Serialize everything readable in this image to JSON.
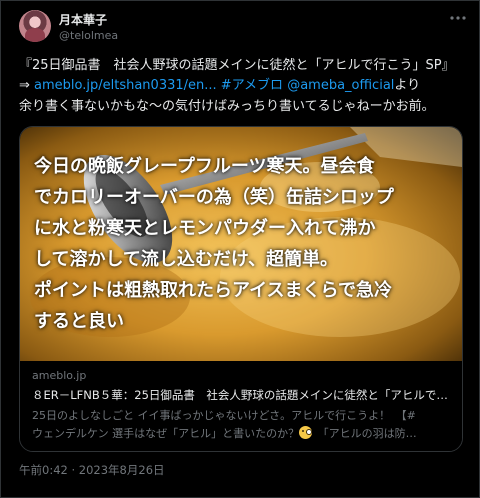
{
  "user": {
    "display_name": "月本華子",
    "handle": "@telolmea"
  },
  "icons": {
    "more": "more-icon"
  },
  "tweet": {
    "line1": "『25日御品書　社会人野球の話題メインに徒然と「アヒルで行こう」SP』",
    "line2_prefix": "⇒ ",
    "line2_link": "ameblo.jp/eltshan0331/en...",
    "line2_hashtag": "#アメブロ",
    "line2_mention": "@ameba_official",
    "line2_suffix": "より",
    "line3": "余り書く事ないかもな～の気付けばみっちり書いてるじゃねーかお前。"
  },
  "card": {
    "image_text": [
      "今日の晩飯グレープフルーツ寒天。昼会食",
      "でカロリーオーバーの為（笑）缶詰シロップ",
      "に水と粉寒天とレモンパウダー入れて沸か",
      "して溶かして流し込むだけ、超簡単。",
      "ポイントは粗熱取れたらアイスまくらで急冷",
      "すると良い"
    ],
    "domain": "ameblo.jp",
    "title": "８ER－LFNB５華：25日御品書　社会人野球の話題メインに徒然と「アヒルで…",
    "desc_line1": "25日のよしなしごと イイ事ばっかじゃないけどさ。アヒルで行こうよ！　【#",
    "desc_line2_a": "ウェンデルケン 選手はなぜ「アヒル」と書いたのか？",
    "desc_line2_b": "　「アヒルの羽は防…"
  },
  "timestamp": "午前0:42 · 2023年8月26日"
}
